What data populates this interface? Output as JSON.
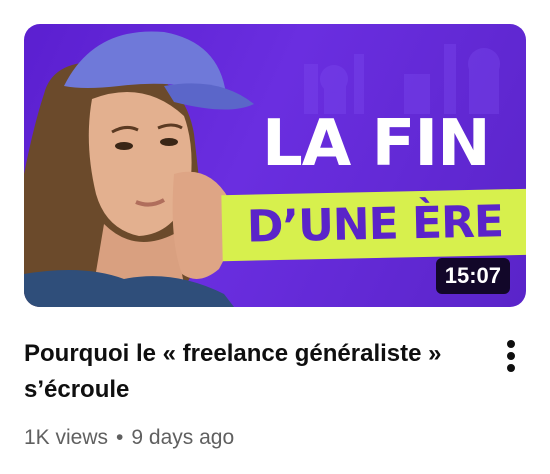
{
  "video": {
    "thumbnail": {
      "headline_line1": "LA FIN",
      "headline_line2": "D’UNE ÈRE",
      "duration": "15:07",
      "colors": {
        "background": "#6a2ee0",
        "highlight": "#d7f04d",
        "headline_text": "#ffffff",
        "highlight_text": "#5a24c9"
      }
    },
    "title": "Pourquoi le « freelance généraliste » s’écroule",
    "views": "1K views",
    "separator": "•",
    "age": "9 days ago",
    "menu_icon": "more-vertical-icon"
  }
}
